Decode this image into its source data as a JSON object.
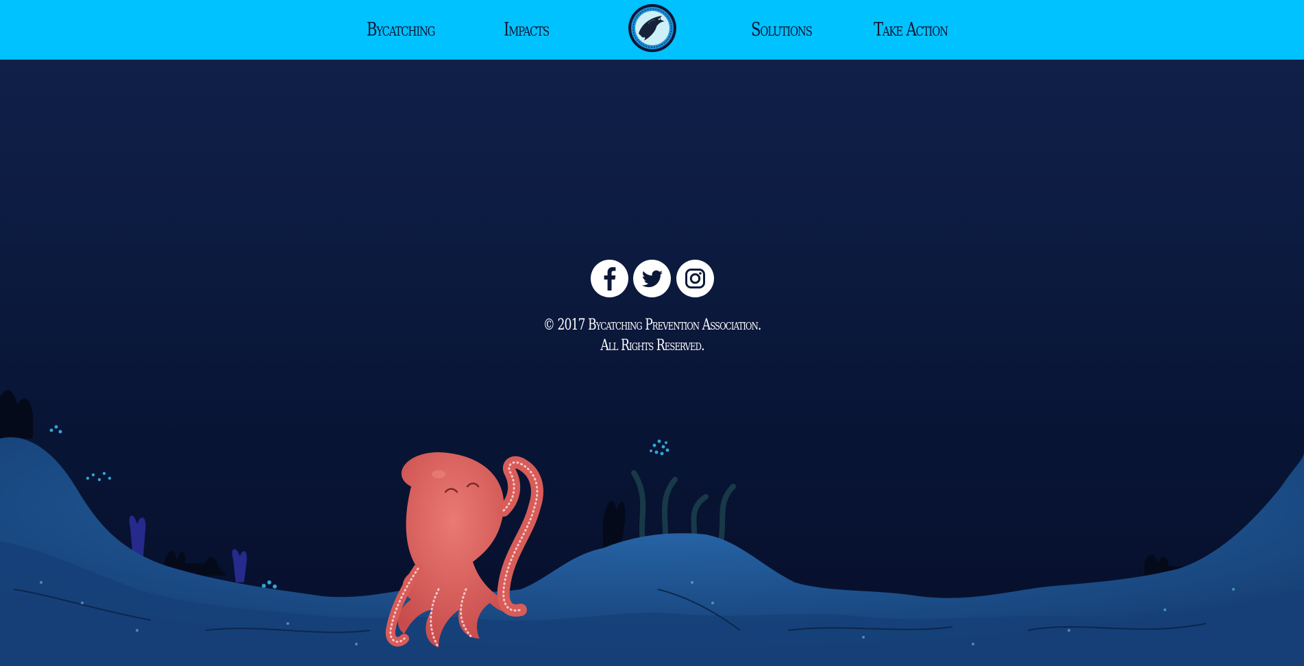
{
  "nav": {
    "items": [
      {
        "label": "Bycatching"
      },
      {
        "label": "Impacts"
      },
      {
        "label": "Solutions"
      },
      {
        "label": "Take Action"
      }
    ],
    "logo_icon": "dolphin-logo-icon",
    "background_color": "#00c2ff"
  },
  "social": {
    "links": [
      {
        "icon": "facebook-icon"
      },
      {
        "icon": "twitter-icon"
      },
      {
        "icon": "instagram-icon"
      }
    ]
  },
  "footer": {
    "copyright_line1": "© 2017 Bycatching Prevention Association.",
    "copyright_line2": "All Rights Reserved."
  },
  "colors": {
    "page_background": "#0b1838",
    "octopus": "#e0625f",
    "seabed": "#1a4f8c"
  }
}
